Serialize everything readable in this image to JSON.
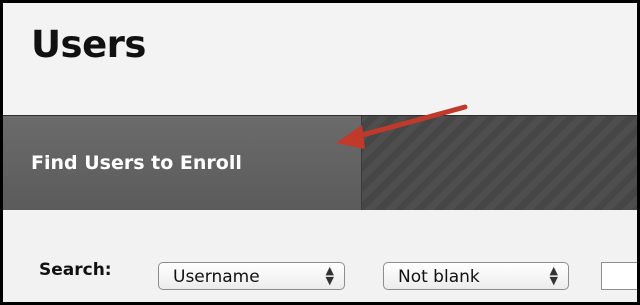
{
  "page": {
    "title": "Users"
  },
  "action_bar": {
    "find_users_label": "Find Users to Enroll"
  },
  "search": {
    "label": "Search:",
    "field_select": {
      "selected": "Username",
      "icon": "updown-caret-icon"
    },
    "operator_select": {
      "selected": "Not blank",
      "icon": "updown-caret-icon"
    },
    "text_input": {
      "value": ""
    }
  },
  "annotation": {
    "arrow_color": "#c0392b"
  },
  "colors": {
    "action_bar": "#4a4a4a",
    "action_tab": "#626262",
    "frame_border": "#000000"
  }
}
